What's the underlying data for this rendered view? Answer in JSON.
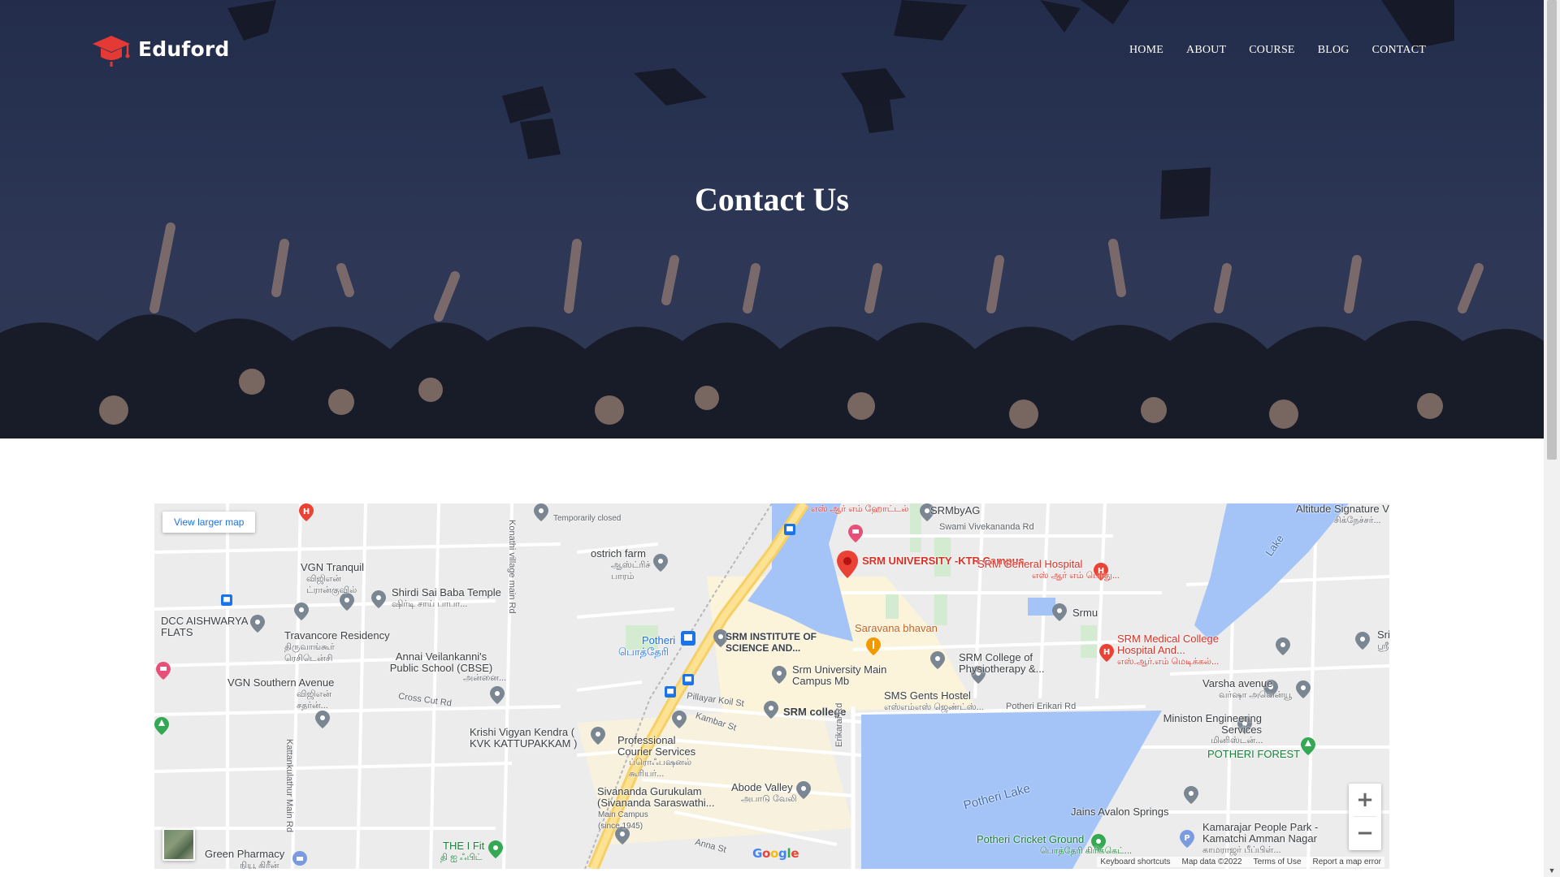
{
  "brand": {
    "name": "Eduford",
    "logo_icon": "graduation-cap-icon",
    "logo_color": "#e53935"
  },
  "nav": {
    "items": [
      "HOME",
      "ABOUT",
      "COURSE",
      "BLOG",
      "CONTACT"
    ]
  },
  "hero": {
    "title": "Contact Us"
  },
  "map": {
    "view_larger": "View larger map",
    "zoom_in": "+",
    "zoom_out": "−",
    "google": "Google",
    "attribution": {
      "shortcuts": "Keyboard shortcuts",
      "data": "Map data ©2022",
      "terms": "Terms of Use",
      "report": "Report a map error"
    },
    "places": {
      "srm_ktr": "SRM UNIVERSITY -KTR Campus",
      "srm_general": "SRM General Hospital",
      "srm_general_ta": "எஸ் ஆர் எம் பொது...",
      "srmbyag": "SRMbyAG",
      "hotel_ta": "எஸ் ஆர் எம் ஹோட்டல்",
      "swami_rd": "Swami Vivekananda Rd",
      "srmu": "Srmu",
      "srm_medical": "SRM Medical College Hospital And...",
      "srm_medical_ta": "எஸ்.ஆர்.எம் மெடிக்கல்...",
      "srm_institute": "SRM INSTITUTE OF SCIENCE AND...",
      "saravana": "Saravana bhavan",
      "srm_physio": "SRM College of Physiotherapy &...",
      "srm_main": "Srm University Main Campus Mb",
      "sms_hostel": "SMS Gents Hostel",
      "sms_hostel_ta": "எஸ்எம்எஸ் ஜெண்ட்ஸ்...",
      "srm_college": "SRM college",
      "potheri_erikari": "Potheri Erikari Rd",
      "potheri": "Potheri",
      "potheri_ta": "பொத்தேரி",
      "pillayar": "Pillayar Koil St",
      "kambar": "Kambar St",
      "professional": "Professional Courier Services",
      "professional_ta": "ப்ரொஃபஷனல் கூரியர்...",
      "abode": "Abode Valley",
      "abode_ta": "அபாடு வேலி",
      "sivananda": "Sivananda Gurukulam (Sivananda Saraswathi...",
      "sivananda_sub": "Main Campus (since 1945)",
      "anna_st": "Anna St",
      "erikarai": "Erikarai Rd",
      "potheri_lake": "Potheri Lake",
      "lake": "Lake",
      "jains": "Jains Avalon Springs",
      "potheri_cricket": "Potheri Cricket Ground",
      "potheri_cricket_ta": "பொத்தேரி கிரிக்கெட்...",
      "kamarajar": "Kamarajar People Park - Kamatchi Amman Nagar",
      "kamarajar_ta": "காமராஜர் பீப்பிள்...",
      "potheri_forest": "POTHERI FOREST",
      "ministon": "Ministon Engineering Services",
      "ministon_ta": "மினிஸ்டன்...",
      "varsha": "Varsha avenue",
      "varsha_ta": "வர்ஷா அவென்யூ",
      "altitude": "Altitude Signature Villa",
      "altitude_ta": "சிக்நேச்சர்...",
      "vgn_tranquil": "VGN Tranquil",
      "vgn_tranquil_ta": "விஜிஎன் ட்ரான்குவில்",
      "shirdi": "Shirdi Sai Baba Temple",
      "shirdi_ta": "ஷிர்டி சாய் பாபா...",
      "ostrich": "ostrich farm",
      "ostrich_ta": "ஆஸ்ட்ரிச் பாரம்",
      "temp_closed": "Temporarily closed",
      "dcc": "DCC AISHWARYA FLATS",
      "travancore": "Travancore Residency",
      "travancore_ta": "திருவாங்கூர் ரெசிடென்சி",
      "annai": "Annai Veilankanni's Public School (CBSE)",
      "annai_ta": "அன்னை...",
      "vgn_southern": "VGN Southern Avenue",
      "vgn_southern_ta": "விஜிஎன் சதர்ன்...",
      "cross_cut": "Cross Cut Rd",
      "krishi": "Krishi Vigyan Kendra ( KVK KATTUPAKKAM )",
      "kattankulathur": "Kattankulathur Main Rd",
      "konathi": "Konathi village main Rd",
      "green_pharmacy": "Green Pharmacy",
      "green_pharmacy_ta": "நியூ கிரீன்",
      "the_i_fit": "THE I Fit",
      "the_i_fit_ta": "தி ஐ ஃபிட்",
      "sri": "Sri",
      "sri_ta": "ஸ்ரீ"
    }
  }
}
